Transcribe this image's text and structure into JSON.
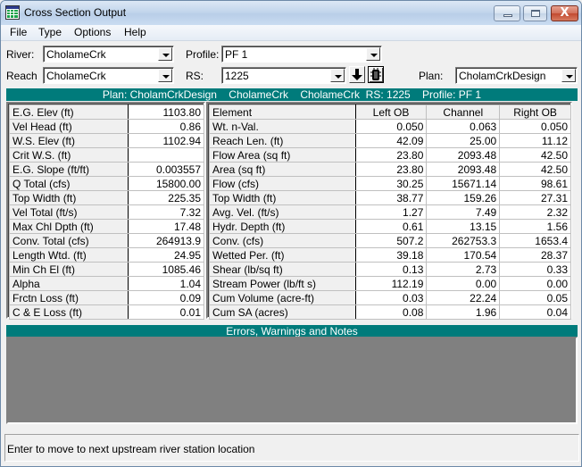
{
  "window": {
    "title": "Cross Section Output",
    "icon": "table-grid-icon",
    "controls": {
      "minimize": "minimize-icon",
      "maximize": "maximize-icon",
      "close": "close-icon",
      "close_glyph": "X"
    }
  },
  "menu": [
    "File",
    "Type",
    "Options",
    "Help"
  ],
  "selectors": {
    "river": {
      "label": "River:",
      "value": "CholameCrk"
    },
    "reach": {
      "label": "Reach",
      "value": "CholameCrk"
    },
    "profile": {
      "label": "Profile:",
      "value": "PF 1"
    },
    "rs": {
      "label": "RS:",
      "value": "1225"
    },
    "plan": {
      "label": "Plan:",
      "value": "CholamCrkDesign"
    },
    "next_down_button": "arrow-down-icon",
    "next_up_button": "bug-icon"
  },
  "header_bar": "Plan: CholamCrkDesign    CholameCrk    CholameCrk  RS: 1225    Profile: PF 1",
  "summary_table": [
    {
      "label": "E.G. Elev (ft)",
      "value": "1103.80"
    },
    {
      "label": "Vel Head (ft)",
      "value": "0.86"
    },
    {
      "label": "W.S. Elev (ft)",
      "value": "1102.94"
    },
    {
      "label": "Crit W.S. (ft)",
      "value": ""
    },
    {
      "label": "E.G. Slope (ft/ft)",
      "value": "0.003557"
    },
    {
      "label": "Q Total (cfs)",
      "value": "15800.00"
    },
    {
      "label": "Top Width (ft)",
      "value": "225.35"
    },
    {
      "label": "Vel Total (ft/s)",
      "value": "7.32"
    },
    {
      "label": "Max Chl Dpth (ft)",
      "value": "17.48"
    },
    {
      "label": "Conv. Total (cfs)",
      "value": "264913.9"
    },
    {
      "label": "Length Wtd. (ft)",
      "value": "24.95"
    },
    {
      "label": "Min Ch El (ft)",
      "value": "1085.46"
    },
    {
      "label": "Alpha",
      "value": "1.04"
    },
    {
      "label": "Frctn Loss (ft)",
      "value": "0.09"
    },
    {
      "label": "C & E Loss (ft)",
      "value": "0.01"
    }
  ],
  "element_table": {
    "headers": [
      "Element",
      "Left OB",
      "Channel",
      "Right OB"
    ],
    "rows": [
      {
        "label": "Wt. n-Val.",
        "left": "0.050",
        "channel": "0.063",
        "right": "0.050"
      },
      {
        "label": "Reach Len. (ft)",
        "left": "42.09",
        "channel": "25.00",
        "right": "11.12"
      },
      {
        "label": "Flow Area (sq ft)",
        "left": "23.80",
        "channel": "2093.48",
        "right": "42.50"
      },
      {
        "label": "Area (sq ft)",
        "left": "23.80",
        "channel": "2093.48",
        "right": "42.50"
      },
      {
        "label": "Flow (cfs)",
        "left": "30.25",
        "channel": "15671.14",
        "right": "98.61"
      },
      {
        "label": "Top Width (ft)",
        "left": "38.77",
        "channel": "159.26",
        "right": "27.31"
      },
      {
        "label": "Avg. Vel. (ft/s)",
        "left": "1.27",
        "channel": "7.49",
        "right": "2.32"
      },
      {
        "label": "Hydr. Depth (ft)",
        "left": "0.61",
        "channel": "13.15",
        "right": "1.56"
      },
      {
        "label": "Conv. (cfs)",
        "left": "507.2",
        "channel": "262753.3",
        "right": "1653.4"
      },
      {
        "label": "Wetted Per. (ft)",
        "left": "39.18",
        "channel": "170.54",
        "right": "28.37"
      },
      {
        "label": "Shear (lb/sq ft)",
        "left": "0.13",
        "channel": "2.73",
        "right": "0.33"
      },
      {
        "label": "Stream Power (lb/ft s)",
        "left": "112.19",
        "channel": "0.00",
        "right": "0.00"
      },
      {
        "label": "Cum Volume (acre-ft)",
        "left": "0.03",
        "channel": "22.24",
        "right": "0.05"
      },
      {
        "label": "Cum SA (acres)",
        "left": "0.08",
        "channel": "1.96",
        "right": "0.04"
      }
    ]
  },
  "notes": {
    "title": "Errors, Warnings and Notes",
    "content": ""
  },
  "status": "Enter to move to next upstream river station location",
  "colors": {
    "teal_header": "#007b7b",
    "notes_bg": "#808080"
  }
}
